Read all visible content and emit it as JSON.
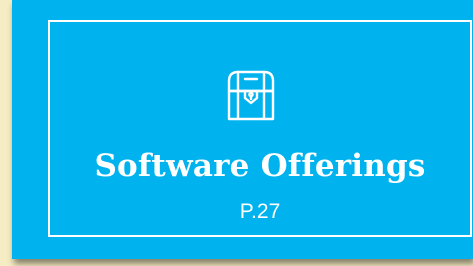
{
  "card": {
    "title": "Software Offerings",
    "page_ref": "P.27",
    "icon": "treasure-chest-icon",
    "background_color": "#00b3ee",
    "text_color": "#ffffff"
  }
}
